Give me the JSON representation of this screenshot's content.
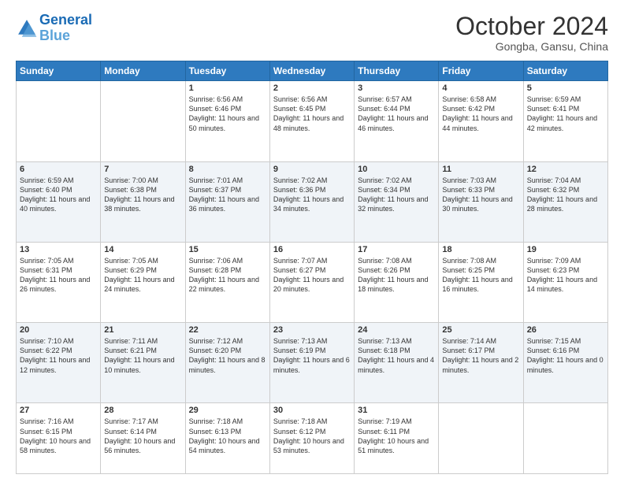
{
  "header": {
    "logo_line1": "General",
    "logo_line2": "Blue",
    "month": "October 2024",
    "location": "Gongba, Gansu, China"
  },
  "weekdays": [
    "Sunday",
    "Monday",
    "Tuesday",
    "Wednesday",
    "Thursday",
    "Friday",
    "Saturday"
  ],
  "weeks": [
    [
      {
        "day": "",
        "sunrise": "",
        "sunset": "",
        "daylight": ""
      },
      {
        "day": "",
        "sunrise": "",
        "sunset": "",
        "daylight": ""
      },
      {
        "day": "1",
        "sunrise": "Sunrise: 6:56 AM",
        "sunset": "Sunset: 6:46 PM",
        "daylight": "Daylight: 11 hours and 50 minutes."
      },
      {
        "day": "2",
        "sunrise": "Sunrise: 6:56 AM",
        "sunset": "Sunset: 6:45 PM",
        "daylight": "Daylight: 11 hours and 48 minutes."
      },
      {
        "day": "3",
        "sunrise": "Sunrise: 6:57 AM",
        "sunset": "Sunset: 6:44 PM",
        "daylight": "Daylight: 11 hours and 46 minutes."
      },
      {
        "day": "4",
        "sunrise": "Sunrise: 6:58 AM",
        "sunset": "Sunset: 6:42 PM",
        "daylight": "Daylight: 11 hours and 44 minutes."
      },
      {
        "day": "5",
        "sunrise": "Sunrise: 6:59 AM",
        "sunset": "Sunset: 6:41 PM",
        "daylight": "Daylight: 11 hours and 42 minutes."
      }
    ],
    [
      {
        "day": "6",
        "sunrise": "Sunrise: 6:59 AM",
        "sunset": "Sunset: 6:40 PM",
        "daylight": "Daylight: 11 hours and 40 minutes."
      },
      {
        "day": "7",
        "sunrise": "Sunrise: 7:00 AM",
        "sunset": "Sunset: 6:38 PM",
        "daylight": "Daylight: 11 hours and 38 minutes."
      },
      {
        "day": "8",
        "sunrise": "Sunrise: 7:01 AM",
        "sunset": "Sunset: 6:37 PM",
        "daylight": "Daylight: 11 hours and 36 minutes."
      },
      {
        "day": "9",
        "sunrise": "Sunrise: 7:02 AM",
        "sunset": "Sunset: 6:36 PM",
        "daylight": "Daylight: 11 hours and 34 minutes."
      },
      {
        "day": "10",
        "sunrise": "Sunrise: 7:02 AM",
        "sunset": "Sunset: 6:34 PM",
        "daylight": "Daylight: 11 hours and 32 minutes."
      },
      {
        "day": "11",
        "sunrise": "Sunrise: 7:03 AM",
        "sunset": "Sunset: 6:33 PM",
        "daylight": "Daylight: 11 hours and 30 minutes."
      },
      {
        "day": "12",
        "sunrise": "Sunrise: 7:04 AM",
        "sunset": "Sunset: 6:32 PM",
        "daylight": "Daylight: 11 hours and 28 minutes."
      }
    ],
    [
      {
        "day": "13",
        "sunrise": "Sunrise: 7:05 AM",
        "sunset": "Sunset: 6:31 PM",
        "daylight": "Daylight: 11 hours and 26 minutes."
      },
      {
        "day": "14",
        "sunrise": "Sunrise: 7:05 AM",
        "sunset": "Sunset: 6:29 PM",
        "daylight": "Daylight: 11 hours and 24 minutes."
      },
      {
        "day": "15",
        "sunrise": "Sunrise: 7:06 AM",
        "sunset": "Sunset: 6:28 PM",
        "daylight": "Daylight: 11 hours and 22 minutes."
      },
      {
        "day": "16",
        "sunrise": "Sunrise: 7:07 AM",
        "sunset": "Sunset: 6:27 PM",
        "daylight": "Daylight: 11 hours and 20 minutes."
      },
      {
        "day": "17",
        "sunrise": "Sunrise: 7:08 AM",
        "sunset": "Sunset: 6:26 PM",
        "daylight": "Daylight: 11 hours and 18 minutes."
      },
      {
        "day": "18",
        "sunrise": "Sunrise: 7:08 AM",
        "sunset": "Sunset: 6:25 PM",
        "daylight": "Daylight: 11 hours and 16 minutes."
      },
      {
        "day": "19",
        "sunrise": "Sunrise: 7:09 AM",
        "sunset": "Sunset: 6:23 PM",
        "daylight": "Daylight: 11 hours and 14 minutes."
      }
    ],
    [
      {
        "day": "20",
        "sunrise": "Sunrise: 7:10 AM",
        "sunset": "Sunset: 6:22 PM",
        "daylight": "Daylight: 11 hours and 12 minutes."
      },
      {
        "day": "21",
        "sunrise": "Sunrise: 7:11 AM",
        "sunset": "Sunset: 6:21 PM",
        "daylight": "Daylight: 11 hours and 10 minutes."
      },
      {
        "day": "22",
        "sunrise": "Sunrise: 7:12 AM",
        "sunset": "Sunset: 6:20 PM",
        "daylight": "Daylight: 11 hours and 8 minutes."
      },
      {
        "day": "23",
        "sunrise": "Sunrise: 7:13 AM",
        "sunset": "Sunset: 6:19 PM",
        "daylight": "Daylight: 11 hours and 6 minutes."
      },
      {
        "day": "24",
        "sunrise": "Sunrise: 7:13 AM",
        "sunset": "Sunset: 6:18 PM",
        "daylight": "Daylight: 11 hours and 4 minutes."
      },
      {
        "day": "25",
        "sunrise": "Sunrise: 7:14 AM",
        "sunset": "Sunset: 6:17 PM",
        "daylight": "Daylight: 11 hours and 2 minutes."
      },
      {
        "day": "26",
        "sunrise": "Sunrise: 7:15 AM",
        "sunset": "Sunset: 6:16 PM",
        "daylight": "Daylight: 11 hours and 0 minutes."
      }
    ],
    [
      {
        "day": "27",
        "sunrise": "Sunrise: 7:16 AM",
        "sunset": "Sunset: 6:15 PM",
        "daylight": "Daylight: 10 hours and 58 minutes."
      },
      {
        "day": "28",
        "sunrise": "Sunrise: 7:17 AM",
        "sunset": "Sunset: 6:14 PM",
        "daylight": "Daylight: 10 hours and 56 minutes."
      },
      {
        "day": "29",
        "sunrise": "Sunrise: 7:18 AM",
        "sunset": "Sunset: 6:13 PM",
        "daylight": "Daylight: 10 hours and 54 minutes."
      },
      {
        "day": "30",
        "sunrise": "Sunrise: 7:18 AM",
        "sunset": "Sunset: 6:12 PM",
        "daylight": "Daylight: 10 hours and 53 minutes."
      },
      {
        "day": "31",
        "sunrise": "Sunrise: 7:19 AM",
        "sunset": "Sunset: 6:11 PM",
        "daylight": "Daylight: 10 hours and 51 minutes."
      },
      {
        "day": "",
        "sunrise": "",
        "sunset": "",
        "daylight": ""
      },
      {
        "day": "",
        "sunrise": "",
        "sunset": "",
        "daylight": ""
      }
    ]
  ]
}
